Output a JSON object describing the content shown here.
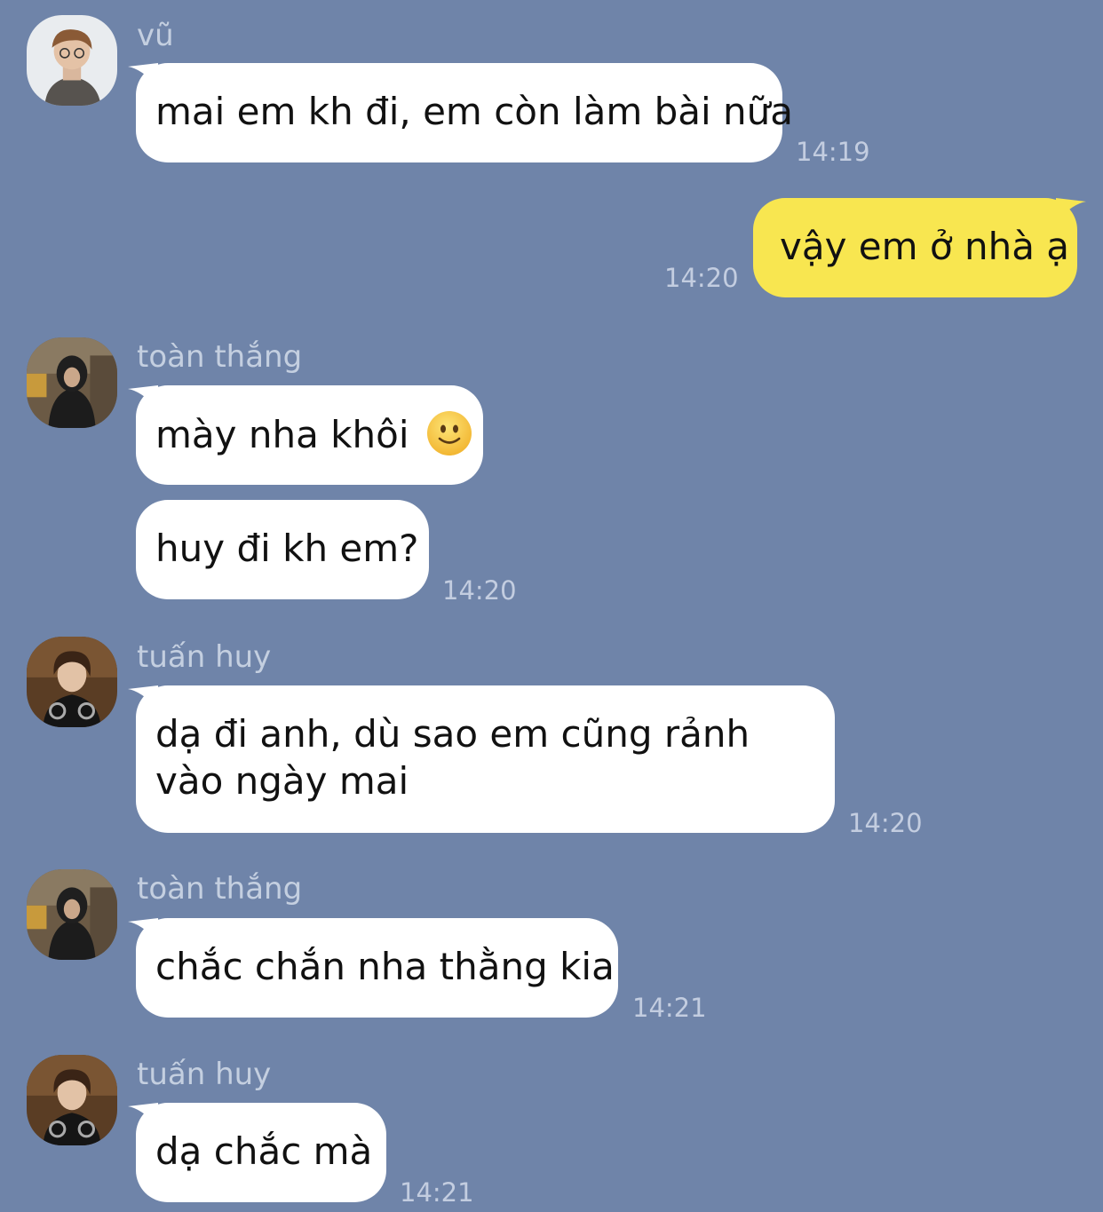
{
  "messages": [
    {
      "sender": "vũ",
      "text": "mai em kh đi, em còn làm bài nữa",
      "time": "14:19",
      "avatar": "avatar-vu"
    },
    {
      "sender": "me",
      "text": "vậy em ở nhà ạ",
      "time": "14:20"
    },
    {
      "sender": "toàn thắng",
      "text": "mày nha khôi",
      "emoji": "slightly-smiling-face",
      "avatar": "avatar-toan-thang"
    },
    {
      "sender": "toàn thắng",
      "text": "huy đi kh em?",
      "time": "14:20"
    },
    {
      "sender": "tuấn huy",
      "text": "dạ đi anh, dù sao em cũng rảnh vào ngày mai",
      "time": "14:20",
      "avatar": "avatar-tuan-huy"
    },
    {
      "sender": "toàn thắng",
      "text": "chắc chắn nha thằng kia",
      "time": "14:21",
      "avatar": "avatar-toan-thang"
    },
    {
      "sender": "tuấn huy",
      "text": "dạ chắc mà",
      "time": "14:21",
      "avatar": "avatar-tuan-huy"
    }
  ],
  "colors": {
    "background": "#6f84a9",
    "incoming_bubble": "#ffffff",
    "outgoing_bubble": "#f8e650",
    "meta_text": "#c4cfe0"
  }
}
